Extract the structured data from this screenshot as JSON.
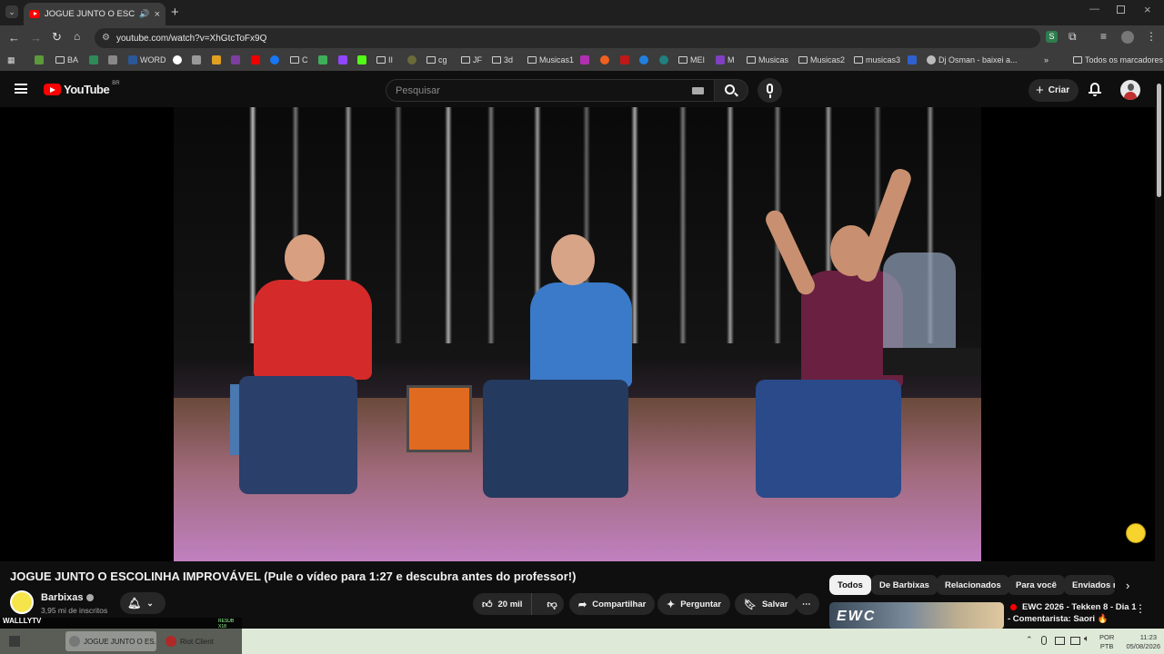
{
  "browser": {
    "tab_title": "JOGUE JUNTO O ESCOLINH",
    "url": "youtube.com/watch?v=XhGtcToFx9Q",
    "bookmarks": [
      "BA",
      "WORD",
      "C",
      "II",
      "cg",
      "JF",
      "3d",
      "Musicas1",
      "MEI",
      "M",
      "Musicas",
      "Musicas2",
      "musicas3",
      "Dj Osman - baixei a...",
      "Todos os marcadores"
    ]
  },
  "youtube": {
    "logo_text": "YouTube",
    "region": "BR",
    "search_placeholder": "Pesquisar",
    "create_label": "Criar"
  },
  "video": {
    "title": "JOGUE JUNTO O ESCOLINHA IMPROVÁVEL (Pule o vídeo para 1:27 e descubra antes do professor!)",
    "channel_name": "Barbixas",
    "subscribers": "3,95 mi de inscritos",
    "likes": "20 mil",
    "share_label": "Compartilhar",
    "ask_label": "Perguntar",
    "save_label": "Salvar"
  },
  "chips": [
    "Todos",
    "De Barbixas",
    "Relacionados",
    "Para você",
    "Enviados r"
  ],
  "recommended": {
    "title_line1": "EWC 2026 - Tekken 8 - Dia 1",
    "title_line2": "- Comentarista: Saori 🔥",
    "thumb_text": "EWC"
  },
  "taskbar": {
    "overlay_label": "WALLLYTV",
    "overlay_small": "RESUB X18",
    "items": [
      "JOGUE JUNTO O ES...",
      "Riot Client"
    ],
    "lang_line1": "POR",
    "lang_line2": "PTB",
    "time": "11:23",
    "date": "05/08/2026"
  },
  "colors": {
    "youtube_red": "#ff0000",
    "background": "#0f0f0f",
    "chip_active": "#f1f1f1"
  }
}
